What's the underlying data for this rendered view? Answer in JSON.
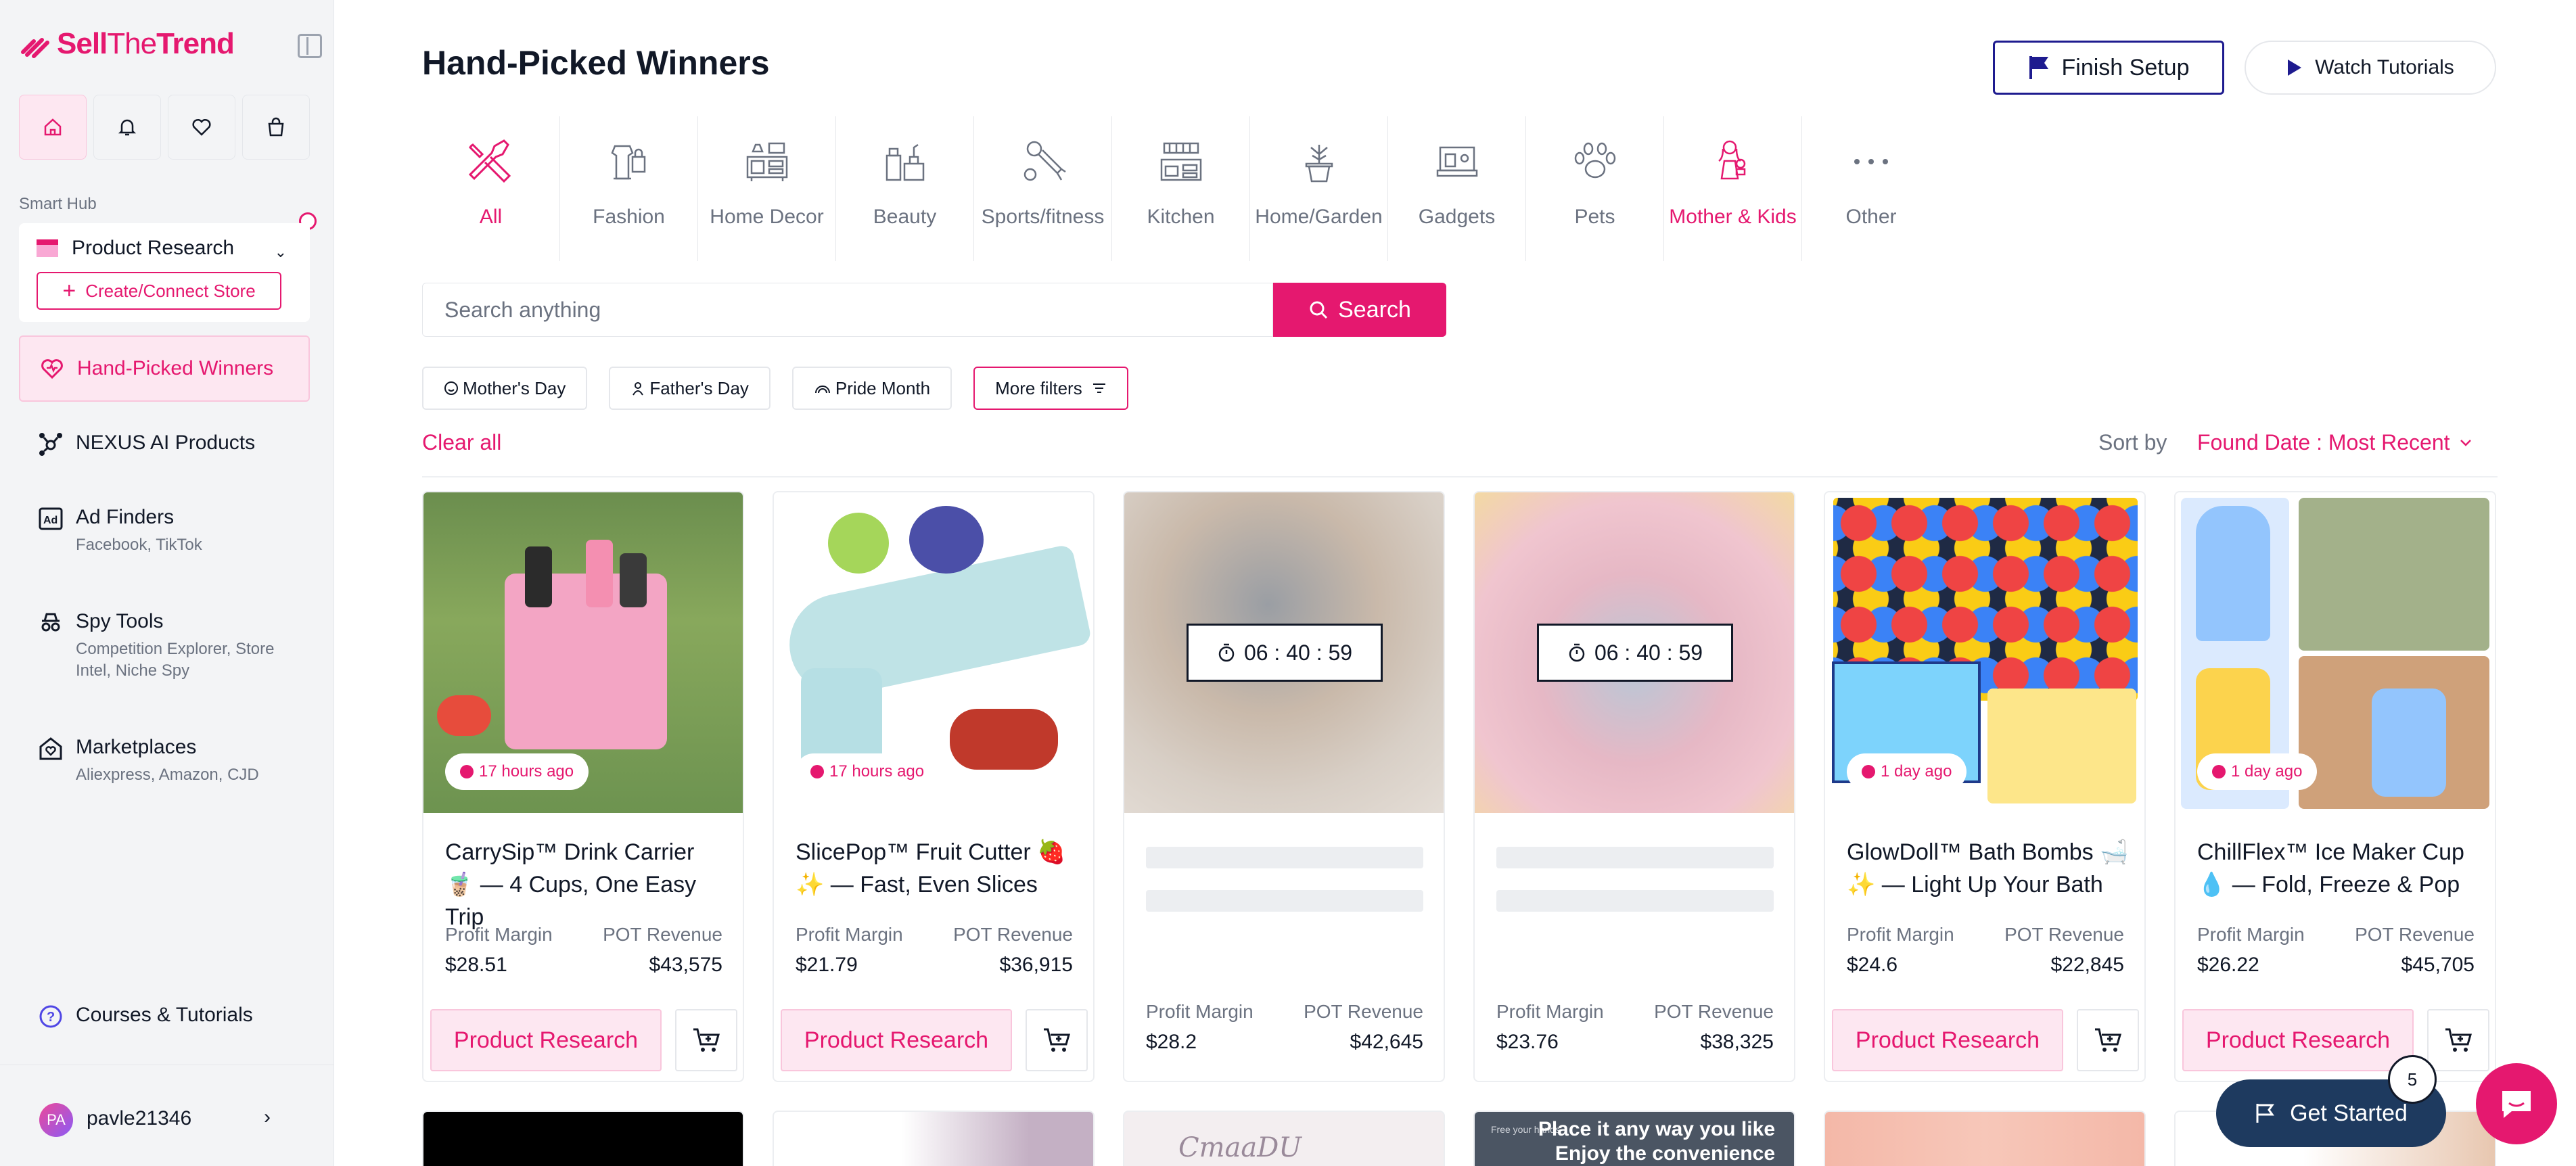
{
  "brand": {
    "name_bold": "Sell",
    "name_thin": "The",
    "name_rest": "Trend",
    "accent": "#e5186f"
  },
  "sidebar": {
    "smart_hub_label": "Smart Hub",
    "hub_select": "Product Research",
    "connect_label": "Create/Connect Store",
    "items": [
      {
        "label": "Hand-Picked Winners",
        "sub": "",
        "icon": "heart-icon",
        "active": true
      },
      {
        "label": "NEXUS AI Products",
        "sub": "",
        "icon": "nexus-network-icon"
      },
      {
        "label": "Ad Finders",
        "sub": "Facebook, TikTok",
        "icon": "ad-icon"
      },
      {
        "label": "Spy Tools",
        "sub": "Competition Explorer, Store Intel, Niche Spy",
        "icon": "spy-icon"
      },
      {
        "label": "Marketplaces",
        "sub": "Aliexpress, Amazon, CJD",
        "icon": "marketplace-icon"
      }
    ],
    "courses_label": "Courses & Tutorials",
    "user": {
      "initials": "PA",
      "name": "pavle21346"
    }
  },
  "header": {
    "title": "Hand-Picked Winners",
    "finish_setup": "Finish Setup",
    "watch_tutorials": "Watch Tutorials"
  },
  "categories": [
    {
      "label": "All",
      "icon": "tools-icon",
      "state": "active"
    },
    {
      "label": "Fashion",
      "icon": "fashion-icon"
    },
    {
      "label": "Home Decor",
      "icon": "home-decor-icon"
    },
    {
      "label": "Beauty",
      "icon": "beauty-icon"
    },
    {
      "label": "Sports/fitness",
      "icon": "sports-icon"
    },
    {
      "label": "Kitchen",
      "icon": "kitchen-icon"
    },
    {
      "label": "Home/Garden",
      "icon": "garden-icon"
    },
    {
      "label": "Gadgets",
      "icon": "gadgets-icon"
    },
    {
      "label": "Pets",
      "icon": "paw-icon"
    },
    {
      "label": "Mother & Kids",
      "icon": "mother-kids-icon",
      "state": "pink"
    },
    {
      "label": "Other",
      "icon": "more-icon"
    }
  ],
  "search": {
    "placeholder": "Search anything",
    "button": "Search"
  },
  "filters": {
    "chips": [
      "Mother's Day",
      "Father's Day",
      "Pride Month"
    ],
    "more_filters": "More filters",
    "clear_all": "Clear all",
    "sort_label": "Sort by",
    "sort_value": "Found Date : Most Recent"
  },
  "card_labels": {
    "profit_margin": "Profit Margin",
    "pot_revenue": "POT Revenue",
    "action": "Product Research"
  },
  "products": [
    {
      "title": "CarrySip™ Drink Carrier 🧋 — 4 Cups, One Easy Trip",
      "time": "17 hours ago",
      "margin": "$28.51",
      "revenue": "$43,575",
      "locked": false
    },
    {
      "title": "SlicePop™ Fruit Cutter 🍓✨ — Fast, Even Slices",
      "time": "17 hours ago",
      "margin": "$21.79",
      "revenue": "$36,915",
      "locked": false
    },
    {
      "title": "",
      "timer": "06 : 40 : 59",
      "margin": "$28.2",
      "revenue": "$42,645",
      "locked": true
    },
    {
      "title": "",
      "timer": "06 : 40 : 59",
      "margin": "$23.76",
      "revenue": "$38,325",
      "locked": true
    },
    {
      "title": "GlowDoll™ Bath Bombs 🛁✨ — Light Up Your Bath",
      "time": "1 day ago",
      "margin": "$24.6",
      "revenue": "$22,845",
      "locked": false
    },
    {
      "title": "ChillFlex™ Ice Maker Cup 💧 — Fold, Freeze & Pop",
      "time": "1 day ago",
      "margin": "$26.22",
      "revenue": "$45,705",
      "locked": false
    }
  ],
  "row2": {
    "promo_small": "Free your hands",
    "promo_line1": "Place it any way you like",
    "promo_line2": "Enjoy the convenience",
    "brand_text": "CmaaDU"
  },
  "floating": {
    "get_started": "Get Started",
    "badge": "5"
  }
}
